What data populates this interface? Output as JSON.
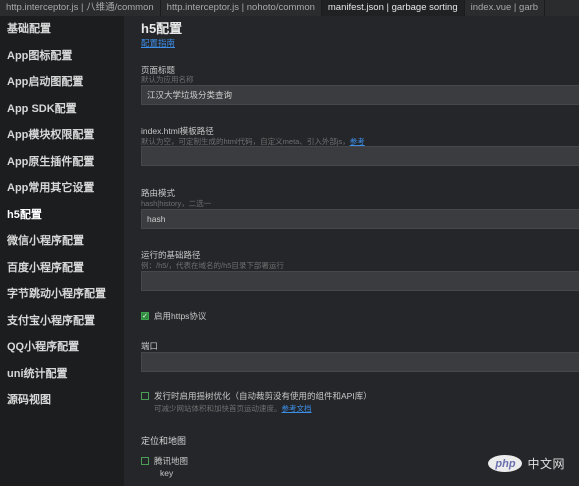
{
  "tabs": [
    {
      "label": "http.interceptor.js | 八维通/common",
      "active": false
    },
    {
      "label": "http.interceptor.js | nohoto/common",
      "active": false
    },
    {
      "label": "manifest.json | garbage sorting",
      "active": true
    },
    {
      "label": "index.vue | garb",
      "active": false
    }
  ],
  "sidebar": {
    "items": [
      {
        "label": "基础配置"
      },
      {
        "label": "App图标配置"
      },
      {
        "label": "App启动图配置"
      },
      {
        "label": "App SDK配置"
      },
      {
        "label": "App模块权限配置"
      },
      {
        "label": "App原生插件配置"
      },
      {
        "label": "App常用其它设置"
      },
      {
        "label": "h5配置"
      },
      {
        "label": "微信小程序配置"
      },
      {
        "label": "百度小程序配置"
      },
      {
        "label": "字节跳动小程序配置"
      },
      {
        "label": "支付宝小程序配置"
      },
      {
        "label": "QQ小程序配置"
      },
      {
        "label": "uni统计配置"
      },
      {
        "label": "源码视图"
      }
    ]
  },
  "main": {
    "title": "h5配置",
    "guide_link": "配置指南",
    "page_title": {
      "label": "页面标题",
      "hint": "默认为应用名称",
      "value": "江汉大学垃圾分类查询"
    },
    "template_path": {
      "label": "index.html模板路径",
      "hint": "默认为空，可定制生成的html代码，自定义meta、引入外部js，",
      "hint_link": "参考",
      "value": ""
    },
    "router_mode": {
      "label": "路由模式",
      "hint": "hash|history，二选一",
      "value": "hash"
    },
    "base_path": {
      "label": "运行的基础路径",
      "hint": "例：/h5/，代表在域名的/h5目录下部署运行",
      "value": ""
    },
    "https": {
      "label": "启用https协议",
      "checked": true
    },
    "port": {
      "label": "端口",
      "value": ""
    },
    "treeshake": {
      "label": "发行时启用摇树优化（自动裁剪没有使用的组件和API库）",
      "hint": "可减少网站体积和加快首页运动速度。",
      "hint_link": "参考文档",
      "checked": false
    },
    "location_section": "定位和地图",
    "tencent_map": {
      "label": "腾讯地图",
      "checked": false,
      "key_label": "key"
    }
  },
  "watermark": {
    "badge": "php",
    "text": "中文网"
  }
}
